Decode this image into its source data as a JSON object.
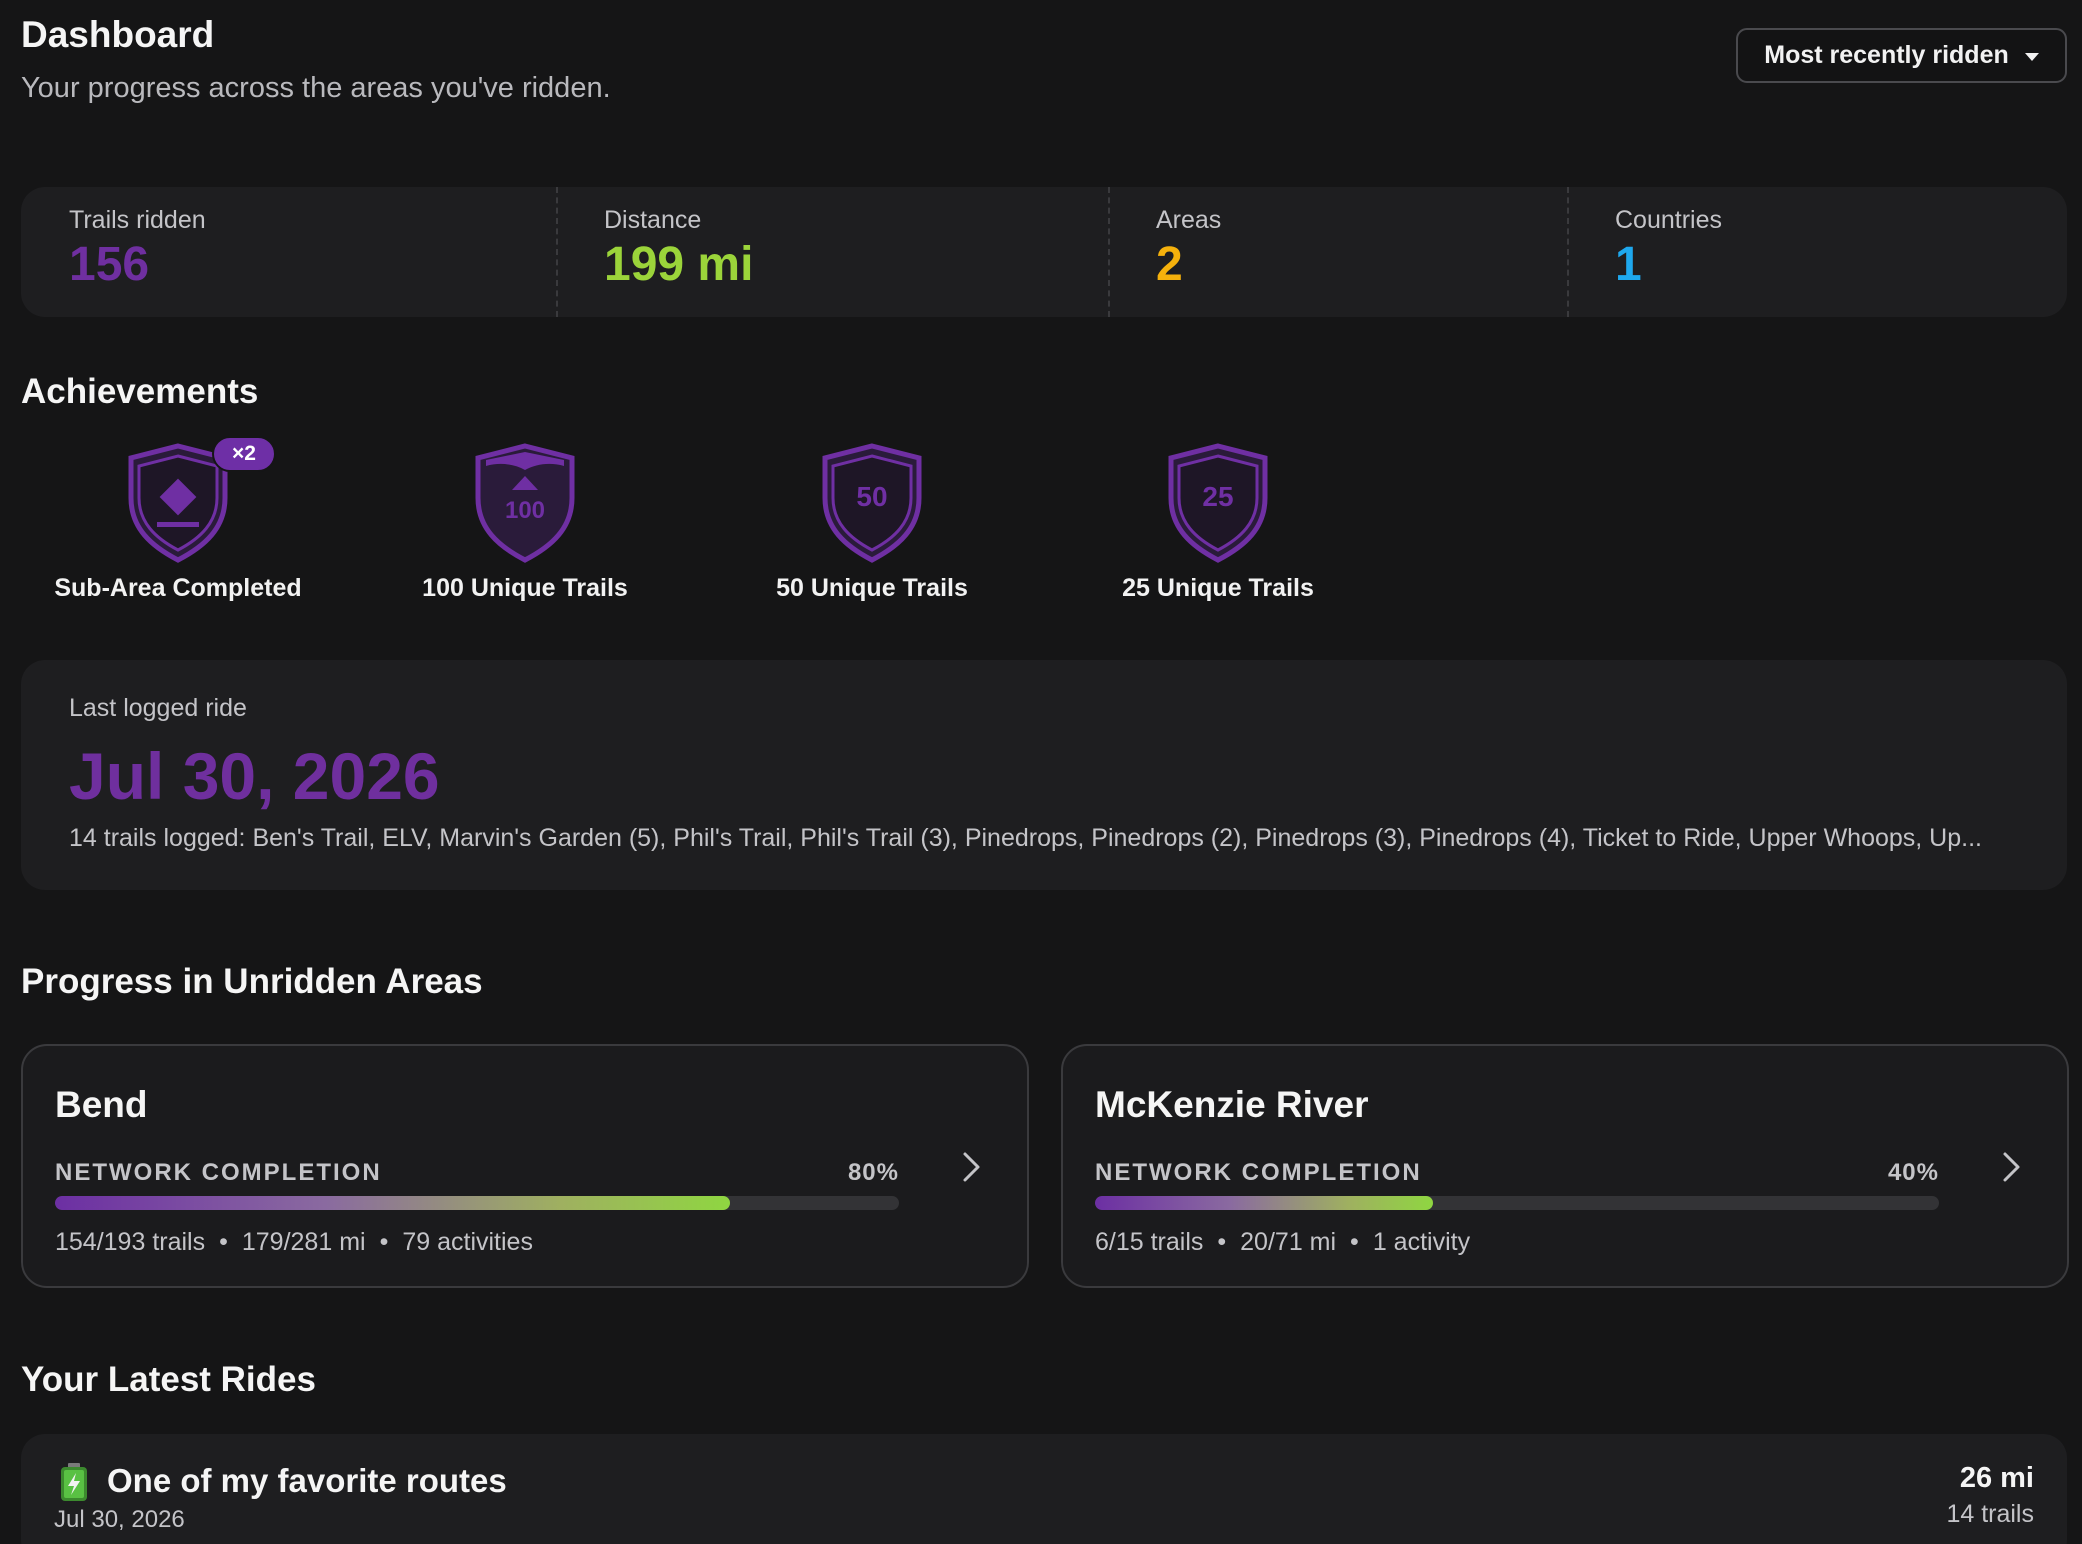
{
  "header": {
    "title": "Dashboard",
    "subtitle": "Your progress across the areas you've ridden.",
    "sort_label": "Most recently ridden"
  },
  "stats": [
    {
      "label": "Trails ridden",
      "value": "156",
      "color": "#6f2fa0"
    },
    {
      "label": "Distance",
      "value": "199 mi",
      "color": "#9bd43a"
    },
    {
      "label": "Areas",
      "value": "2",
      "color": "#f5b10c"
    },
    {
      "label": "Countries",
      "value": "1",
      "color": "#1ea8ee"
    }
  ],
  "achievements": {
    "title": "Achievements",
    "items": [
      {
        "label": "Sub-Area Completed",
        "badge_text": "",
        "multiplier": "×2",
        "icon": "diamond-shield-icon"
      },
      {
        "label": "100 Unique Trails",
        "badge_text": "100",
        "icon": "mountain-shield-icon"
      },
      {
        "label": "50 Unique Trails",
        "badge_text": "50",
        "icon": "shield-icon"
      },
      {
        "label": "25 Unique Trails",
        "badge_text": "25",
        "icon": "shield-icon"
      }
    ]
  },
  "last_ride": {
    "label": "Last logged ride",
    "date": "Jul 30, 2026",
    "trails": "14 trails logged: Ben's Trail, ELV, Marvin's Garden (5), Phil's Trail, Phil's Trail (3), Pinedrops, Pinedrops (2), Pinedrops (3), Pinedrops (4), Ticket to Ride, Upper Whoops, Up..."
  },
  "unridden": {
    "title": "Progress in Unridden Areas",
    "areas": [
      {
        "name": "Bend",
        "completion_label": "NETWORK COMPLETION",
        "percent": "80%",
        "progress": 0.8,
        "trails": "154/193 trails",
        "distance": "179/281 mi",
        "activities": "79 activities"
      },
      {
        "name": "McKenzie River",
        "completion_label": "NETWORK COMPLETION",
        "percent": "40%",
        "progress": 0.4,
        "trails": "6/15 trails",
        "distance": "20/71 mi",
        "activities": "1 activity"
      }
    ]
  },
  "latest_rides": {
    "title": "Your Latest Rides",
    "items": [
      {
        "name": "One of my favorite routes",
        "date": "Jul 30, 2026",
        "distance": "26 mi",
        "trails": "14 trails",
        "icon": "battery-icon"
      }
    ]
  },
  "meta_separator": "•"
}
